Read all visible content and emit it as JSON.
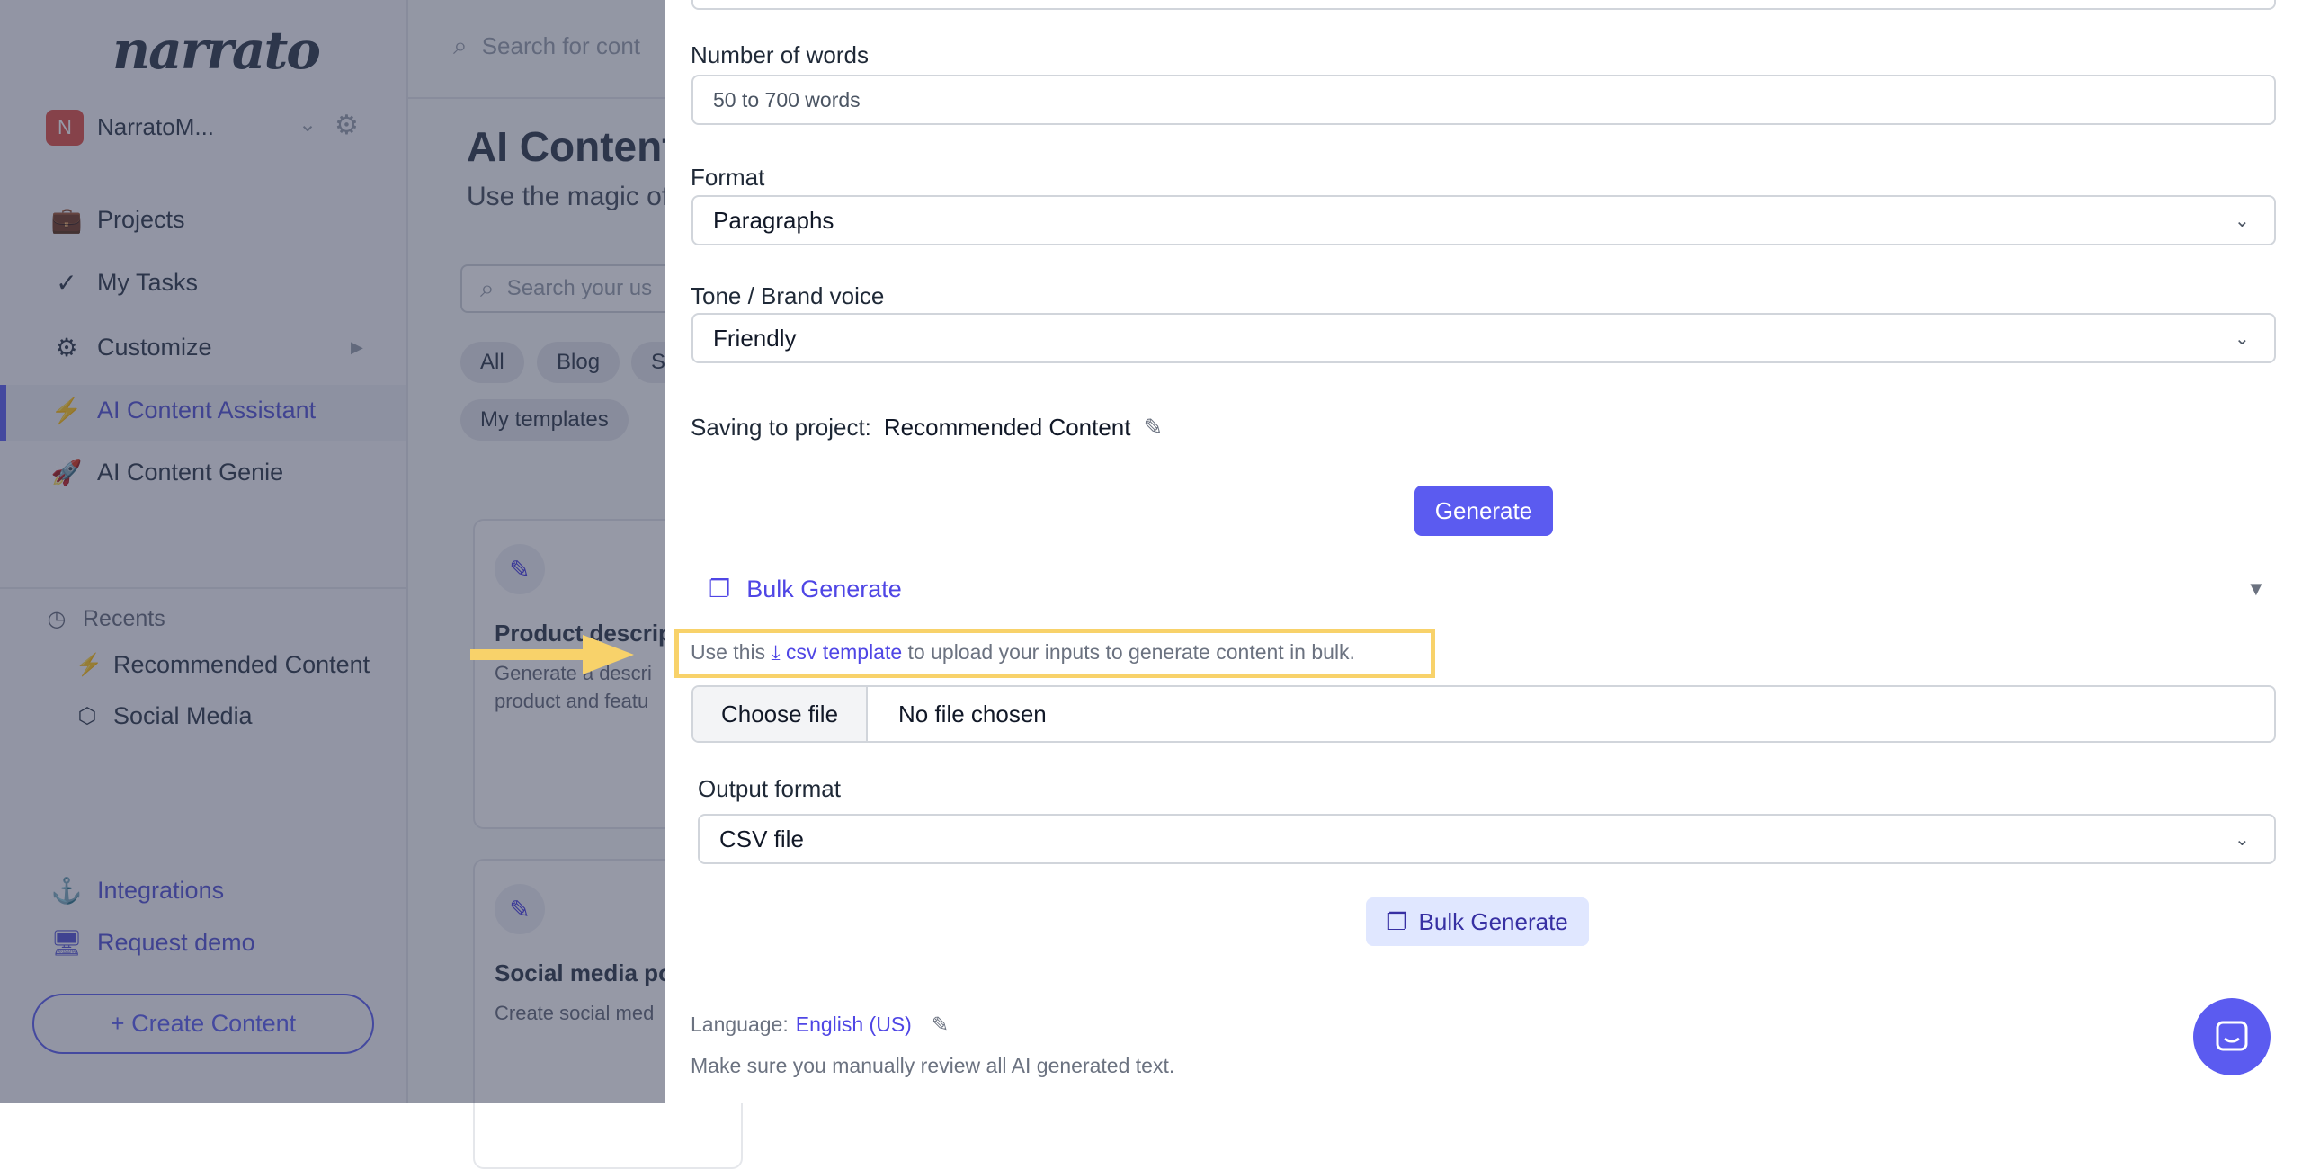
{
  "sidebar": {
    "logo": "narrato",
    "workspace": {
      "initial": "N",
      "name": "NarratoM..."
    },
    "items": [
      {
        "label": "Projects",
        "icon": "briefcase-icon"
      },
      {
        "label": "My Tasks",
        "icon": "double-check-icon"
      },
      {
        "label": "Customize",
        "icon": "gears-icon"
      },
      {
        "label": "AI Content Assistant",
        "icon": "lightning-icon",
        "active": true
      },
      {
        "label": "AI Content Genie",
        "icon": "rocket-icon"
      }
    ],
    "recents_label": "Recents",
    "recents": [
      {
        "label": "Recommended Content",
        "icon": "lightning-icon"
      },
      {
        "label": "Social Media",
        "icon": "cube-icon"
      }
    ],
    "integrations": "Integrations",
    "request_demo": "Request demo",
    "create_content": "+ Create Content"
  },
  "main": {
    "top_search_placeholder": "Search for cont",
    "title": "AI Content",
    "subtitle": "Use the magic of",
    "search_placeholder": "Search your us",
    "chips": [
      "All",
      "Blog",
      "S",
      "My templates"
    ],
    "cards": [
      {
        "title": "Product descrip",
        "desc": [
          "Generate a descri",
          "product and featu"
        ]
      },
      {
        "title": "Social media po",
        "desc": [
          "Create social med"
        ]
      }
    ]
  },
  "modal": {
    "words_label": "Number of words",
    "words_placeholder": "50 to 700 words",
    "format_label": "Format",
    "format_value": "Paragraphs",
    "tone_label": "Tone / Brand voice",
    "tone_value": "Friendly",
    "saving_label": "Saving to project:",
    "saving_project": "Recommended Content",
    "generate": "Generate",
    "bulk_title": "Bulk Generate",
    "helper_pre": "Use this",
    "helper_link": "csv template",
    "helper_post": "to upload your inputs to generate content in bulk.",
    "choose_file": "Choose file",
    "no_file": "No file chosen",
    "output_label": "Output format",
    "output_value": "CSV file",
    "bulk_button": "Bulk Generate",
    "language_label": "Language:",
    "language_value": "English (US)",
    "note": "Make sure you manually review all AI generated text."
  },
  "colors": {
    "accent": "#5b5bf0",
    "highlight": "#f8d26a"
  }
}
